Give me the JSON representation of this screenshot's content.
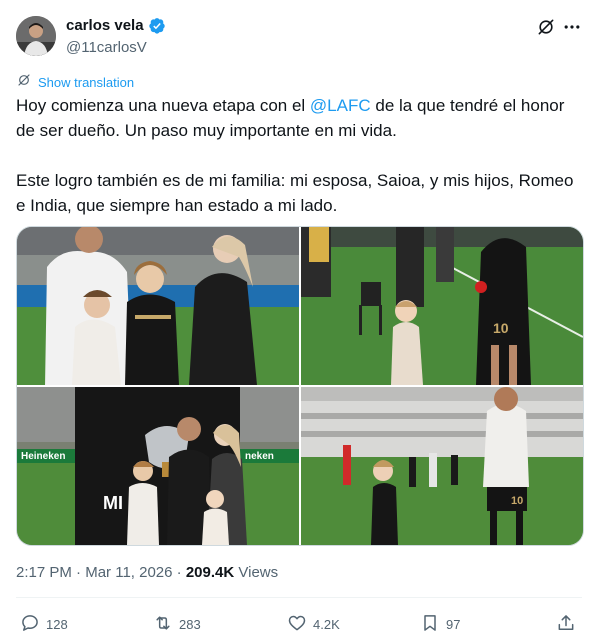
{
  "author": {
    "display_name": "carlos vela",
    "handle": "@11carlosV",
    "verified": true,
    "verified_color": "#1d9bf0"
  },
  "header_icons": [
    "grok-icon",
    "more-icon"
  ],
  "translate": {
    "label": "Show translation"
  },
  "tweet": {
    "line1_before": "Hoy comienza una nueva etapa con el ",
    "mention": "@LAFC",
    "line1_after": " de la que tendré el honor de ser dueño. Un paso muy importante en mi vida.",
    "paragraph2": "Este logro también es de mi familia: mi esposa, Saioa, y mis hijos, Romeo e India, que siempre han estado a mi lado."
  },
  "media": {
    "count": 4,
    "photo_text": {
      "heineken_left": "Heineken",
      "heineken_right": "neken",
      "jersey_number": "10",
      "sign": "MI"
    }
  },
  "meta": {
    "time": "2:17 PM",
    "separator": "·",
    "date": "Mar 11, 2026",
    "views_count": "209.4K",
    "views_label": "Views"
  },
  "actions": {
    "replies": "128",
    "reposts": "283",
    "likes": "4.2K",
    "bookmarks": "97"
  },
  "colors": {
    "accent": "#1d9bf0",
    "text_primary": "#0f1419",
    "text_secondary": "#536471",
    "border": "#cfd9de"
  }
}
